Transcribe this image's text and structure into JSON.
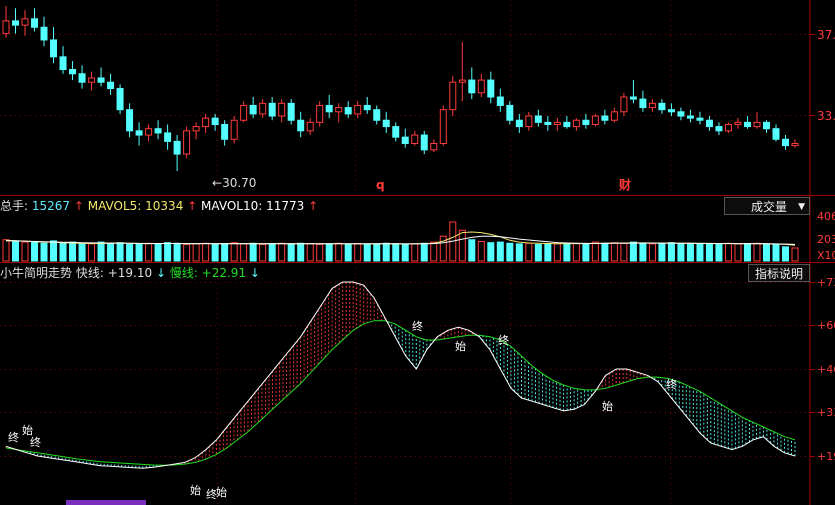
{
  "colors": {
    "up": "#ff3b3b",
    "down": "#54ffff",
    "ma5": "#f2e96b",
    "ma10": "#ffffff",
    "fast": "#ffffff",
    "slow": "#22dd22",
    "axis": "#a00000",
    "label_cyan": "#5ee9ff",
    "label_yellow": "#f2e96b"
  },
  "price_panel": {
    "axis_labels": [
      "37.",
      "33."
    ],
    "low_marker": "30.70",
    "event_tags": [
      "q",
      "财"
    ]
  },
  "volume_panel": {
    "total_label": "总手: ",
    "total_value": "15267",
    "mavol5_label": "MAVOL5: ",
    "mavol5_value": "10334",
    "mavol10_label": "MAVOL10: ",
    "mavol10_value": "11773",
    "dropdown_label": "成交量",
    "axis_labels": [
      "406",
      "203",
      "X10"
    ]
  },
  "indicator_panel": {
    "name": "小牛简明走势",
    "fast_label": "快线: ",
    "fast_value": "+19.10",
    "slow_label": "慢线: ",
    "slow_value": "+22.91",
    "help_button": "指标说明",
    "axis_labels": [
      "+73",
      "+60",
      "+46",
      "+33",
      "+19"
    ],
    "signal_start": "始",
    "signal_end": "终"
  },
  "chart_data": [
    {
      "type": "candlestick",
      "description_values": "approximate daily OHLC in price units",
      "ylim": [
        29.8,
        38.6
      ],
      "candles": [
        [
          37.2,
          38.5,
          37.0,
          37.8
        ],
        [
          37.8,
          38.4,
          37.2,
          37.6
        ],
        [
          37.6,
          38.3,
          37.1,
          37.9
        ],
        [
          37.9,
          38.4,
          37.3,
          37.5
        ],
        [
          37.5,
          38.0,
          36.6,
          36.9
        ],
        [
          36.9,
          37.5,
          35.8,
          36.1
        ],
        [
          36.1,
          36.6,
          35.3,
          35.5
        ],
        [
          35.5,
          35.9,
          35.0,
          35.3
        ],
        [
          35.3,
          35.7,
          34.6,
          34.9
        ],
        [
          34.9,
          35.4,
          34.5,
          35.1
        ],
        [
          35.1,
          35.6,
          34.7,
          34.9
        ],
        [
          34.9,
          35.3,
          34.3,
          34.6
        ],
        [
          34.6,
          34.8,
          33.4,
          33.6
        ],
        [
          33.6,
          33.9,
          32.3,
          32.6
        ],
        [
          32.6,
          33.0,
          31.9,
          32.4
        ],
        [
          32.4,
          32.9,
          32.1,
          32.7
        ],
        [
          32.7,
          33.1,
          32.2,
          32.5
        ],
        [
          32.5,
          32.9,
          31.7,
          32.1
        ],
        [
          32.1,
          32.4,
          30.7,
          31.5
        ],
        [
          31.5,
          32.8,
          31.3,
          32.6
        ],
        [
          32.6,
          33.0,
          32.2,
          32.8
        ],
        [
          32.8,
          33.4,
          32.5,
          33.2
        ],
        [
          33.2,
          33.4,
          32.6,
          32.9
        ],
        [
          32.9,
          33.1,
          31.9,
          32.2
        ],
        [
          32.2,
          33.3,
          32.0,
          33.1
        ],
        [
          33.1,
          34.0,
          33.0,
          33.8
        ],
        [
          33.8,
          34.2,
          33.2,
          33.4
        ],
        [
          33.4,
          34.1,
          33.2,
          33.9
        ],
        [
          33.9,
          34.2,
          33.1,
          33.3
        ],
        [
          33.3,
          34.1,
          33.0,
          33.9
        ],
        [
          33.9,
          34.1,
          32.9,
          33.1
        ],
        [
          33.1,
          33.5,
          32.3,
          32.6
        ],
        [
          32.6,
          33.2,
          32.4,
          33.0
        ],
        [
          33.0,
          34.0,
          32.8,
          33.8
        ],
        [
          33.8,
          34.3,
          33.2,
          33.5
        ],
        [
          33.5,
          33.9,
          33.0,
          33.7
        ],
        [
          33.7,
          34.0,
          33.2,
          33.4
        ],
        [
          33.4,
          34.0,
          33.2,
          33.8
        ],
        [
          33.8,
          34.2,
          33.4,
          33.6
        ],
        [
          33.6,
          33.8,
          32.9,
          33.1
        ],
        [
          33.1,
          33.5,
          32.5,
          32.8
        ],
        [
          32.8,
          33.0,
          32.1,
          32.3
        ],
        [
          32.3,
          32.7,
          31.8,
          32.0
        ],
        [
          32.0,
          32.6,
          31.9,
          32.4
        ],
        [
          32.4,
          32.6,
          31.5,
          31.7
        ],
        [
          31.7,
          32.2,
          31.6,
          32.0
        ],
        [
          32.0,
          33.8,
          31.9,
          33.6
        ],
        [
          33.6,
          35.2,
          33.3,
          34.9
        ],
        [
          34.9,
          36.8,
          34.0,
          35.0
        ],
        [
          35.0,
          35.6,
          34.1,
          34.4
        ],
        [
          34.4,
          35.3,
          34.2,
          35.0
        ],
        [
          35.0,
          35.4,
          33.9,
          34.2
        ],
        [
          34.2,
          34.6,
          33.5,
          33.8
        ],
        [
          33.8,
          34.0,
          32.9,
          33.1
        ],
        [
          33.1,
          33.4,
          32.5,
          32.8
        ],
        [
          32.8,
          33.5,
          32.6,
          33.3
        ],
        [
          33.3,
          33.6,
          32.8,
          33.0
        ],
        [
          33.0,
          33.3,
          32.6,
          32.9
        ],
        [
          32.9,
          33.2,
          32.6,
          33.0
        ],
        [
          33.0,
          33.3,
          32.7,
          32.8
        ],
        [
          32.8,
          33.2,
          32.6,
          33.1
        ],
        [
          33.1,
          33.4,
          32.7,
          32.9
        ],
        [
          32.9,
          33.4,
          32.8,
          33.3
        ],
        [
          33.3,
          33.6,
          32.9,
          33.1
        ],
        [
          33.1,
          33.7,
          33.0,
          33.5
        ],
        [
          33.5,
          34.4,
          33.3,
          34.2
        ],
        [
          34.2,
          35.0,
          33.9,
          34.1
        ],
        [
          34.1,
          34.5,
          33.5,
          33.7
        ],
        [
          33.7,
          34.1,
          33.5,
          33.9
        ],
        [
          33.9,
          34.1,
          33.4,
          33.6
        ],
        [
          33.6,
          33.9,
          33.3,
          33.5
        ],
        [
          33.5,
          33.7,
          33.1,
          33.3
        ],
        [
          33.3,
          33.6,
          33.0,
          33.2
        ],
        [
          33.2,
          33.5,
          32.9,
          33.1
        ],
        [
          33.1,
          33.3,
          32.6,
          32.8
        ],
        [
          32.8,
          33.0,
          32.4,
          32.6
        ],
        [
          32.6,
          33.0,
          32.5,
          32.9
        ],
        [
          32.9,
          33.2,
          32.7,
          33.0
        ],
        [
          33.0,
          33.3,
          32.7,
          32.8
        ],
        [
          32.8,
          33.5,
          32.7,
          33.0
        ],
        [
          33.0,
          33.1,
          32.5,
          32.7
        ],
        [
          32.7,
          32.9,
          32.1,
          32.2
        ],
        [
          32.2,
          32.4,
          31.7,
          31.9
        ],
        [
          31.9,
          32.2,
          31.8,
          32.0
        ]
      ]
    },
    {
      "type": "bar",
      "ylim": [
        0,
        406
      ],
      "values": [
        180,
        170,
        160,
        165,
        150,
        170,
        155,
        160,
        150,
        145,
        160,
        150,
        155,
        140,
        145,
        150,
        145,
        155,
        150,
        140,
        145,
        150,
        140,
        148,
        155,
        145,
        150,
        140,
        145,
        150,
        145,
        150,
        148,
        140,
        145,
        150,
        142,
        148,
        140,
        145,
        150,
        146,
        140,
        145,
        150,
        160,
        210,
        330,
        260,
        180,
        165,
        155,
        160,
        150,
        145,
        150,
        140,
        148,
        145,
        150,
        150,
        145,
        160,
        150,
        155,
        148,
        160,
        150,
        145,
        150,
        155,
        145,
        150,
        148,
        145,
        140,
        150,
        145,
        148,
        150,
        145,
        140,
        120,
        110
      ],
      "ma5": [
        175,
        172,
        168,
        162,
        160,
        160,
        155,
        152,
        150,
        148,
        148,
        150,
        152,
        150,
        148,
        146,
        148,
        148,
        148,
        146,
        146,
        147,
        146,
        147,
        147,
        147,
        147,
        146,
        147,
        147,
        146,
        146,
        146,
        146,
        146,
        146,
        145,
        145,
        145,
        145,
        146,
        145,
        145,
        146,
        147,
        150,
        168,
        200,
        240,
        245,
        240,
        225,
        205,
        175,
        160,
        152,
        150,
        148,
        146,
        147,
        147,
        147,
        148,
        150,
        152,
        152,
        153,
        153,
        152,
        151,
        151,
        150,
        149,
        149,
        148,
        147,
        147,
        146,
        146,
        146,
        145,
        144,
        140,
        134
      ],
      "ma10": [
        170,
        170,
        168,
        165,
        163,
        161,
        159,
        157,
        155,
        153,
        152,
        151,
        151,
        150,
        149,
        148,
        148,
        148,
        148,
        147,
        147,
        147,
        146,
        146,
        146,
        146,
        146,
        146,
        146,
        146,
        146,
        146,
        146,
        146,
        146,
        146,
        146,
        146,
        146,
        146,
        146,
        146,
        145,
        145,
        146,
        147,
        155,
        168,
        185,
        200,
        210,
        210,
        205,
        195,
        185,
        178,
        170,
        162,
        156,
        152,
        150,
        149,
        149,
        149,
        150,
        150,
        151,
        151,
        151,
        151,
        151,
        150,
        150,
        149,
        149,
        148,
        148,
        147,
        147,
        147,
        146,
        145,
        143,
        140
      ]
    },
    {
      "type": "line",
      "ylim": [
        14,
        76
      ],
      "series": [
        {
          "values": [
            22,
            21,
            20,
            19,
            18.5,
            18,
            17.5,
            17,
            16.5,
            16,
            15.8,
            15.6,
            15.4,
            15.2,
            15.5,
            16,
            16.5,
            17,
            18.5,
            21,
            24,
            28,
            32,
            36,
            40,
            44,
            48,
            52,
            56,
            61,
            66,
            71,
            73,
            73,
            72,
            68,
            62,
            56,
            50,
            46,
            52,
            56,
            58,
            59,
            58,
            56,
            52,
            46,
            40,
            37,
            36,
            35,
            34,
            33,
            33.5,
            35,
            39,
            44,
            46,
            46,
            45,
            44,
            42,
            38,
            34,
            30,
            26,
            23,
            22,
            21,
            22,
            24,
            25,
            22,
            20,
            19
          ]
        },
        {
          "values": [
            21.5,
            21,
            20.5,
            20,
            19.5,
            19,
            18.5,
            18,
            17.6,
            17.2,
            17,
            16.8,
            16.6,
            16.4,
            16.2,
            16.1,
            16.2,
            16.5,
            17,
            18,
            19.5,
            21.5,
            24,
            26.5,
            29.5,
            32.5,
            35.5,
            38.5,
            41.5,
            45,
            48.5,
            52,
            55,
            58,
            60,
            61,
            61,
            60,
            58,
            56,
            55,
            55,
            55.5,
            56,
            56.5,
            56.5,
            56,
            55,
            53,
            50,
            47,
            44.5,
            42.5,
            41,
            40,
            39.5,
            39.5,
            40,
            41,
            42,
            43,
            43.5,
            43.5,
            43,
            42,
            40.5,
            39,
            37,
            35,
            33,
            31,
            29.5,
            28,
            26.5,
            25,
            24
          ]
        }
      ]
    }
  ]
}
